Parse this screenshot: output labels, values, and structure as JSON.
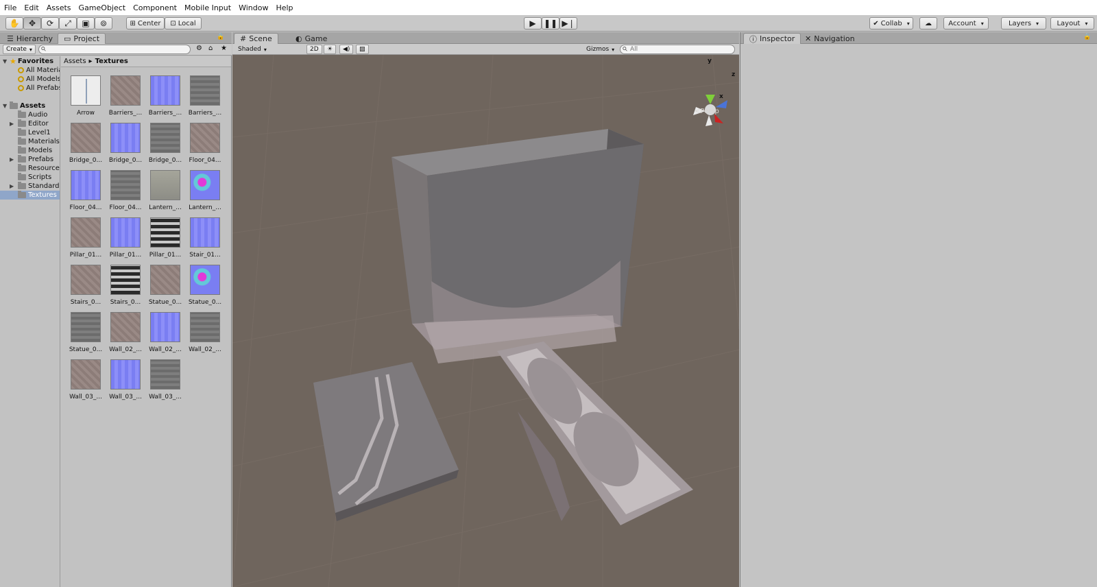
{
  "menu": [
    "File",
    "Edit",
    "Assets",
    "GameObject",
    "Component",
    "Mobile Input",
    "Window",
    "Help"
  ],
  "toolbar": {
    "tools": [
      "hand-icon",
      "move-icon",
      "rotate-icon",
      "scale-icon",
      "rect-icon",
      "transform-icon"
    ],
    "pivot": "Center",
    "space": "Local",
    "collab": "Collab",
    "account": "Account",
    "layers": "Layers",
    "layout": "Layout"
  },
  "left_tabs": {
    "hierarchy": "Hierarchy",
    "project": "Project"
  },
  "project_bar": {
    "create": "Create"
  },
  "tree": {
    "favorites": "Favorites",
    "fav_items": [
      "All Materials",
      "All Models",
      "All Prefabs"
    ],
    "assets": "Assets",
    "folders": [
      "Audio",
      "Editor",
      "Level1",
      "Materials",
      "Models",
      "Prefabs",
      "Resources",
      "Scripts",
      "Standard Assets",
      "Textures"
    ]
  },
  "breadcrumb": {
    "root": "Assets",
    "current": "Textures"
  },
  "textures": [
    {
      "name": "Arrow",
      "kind": "arrow"
    },
    {
      "name": "Barriers_...",
      "kind": "diff"
    },
    {
      "name": "Barriers_...",
      "kind": "norm"
    },
    {
      "name": "Barriers_...",
      "kind": "gray"
    },
    {
      "name": "Bridge_0...",
      "kind": "diff"
    },
    {
      "name": "Bridge_0...",
      "kind": "norm"
    },
    {
      "name": "Bridge_0...",
      "kind": "gray"
    },
    {
      "name": "Floor_04...",
      "kind": "diff"
    },
    {
      "name": "Floor_04...",
      "kind": "norm"
    },
    {
      "name": "Floor_04...",
      "kind": "gray"
    },
    {
      "name": "Lantern_...",
      "kind": "lant"
    },
    {
      "name": "Lantern_...",
      "kind": "lantn"
    },
    {
      "name": "Pillar_01...",
      "kind": "diff"
    },
    {
      "name": "Pillar_01...",
      "kind": "norm"
    },
    {
      "name": "Pillar_01...",
      "kind": "dark"
    },
    {
      "name": "Stair_01...",
      "kind": "norm"
    },
    {
      "name": "Stairs_0...",
      "kind": "diff"
    },
    {
      "name": "Stairs_0...",
      "kind": "dark"
    },
    {
      "name": "Statue_0...",
      "kind": "diff"
    },
    {
      "name": "Statue_0...",
      "kind": "lantn"
    },
    {
      "name": "Statue_0...",
      "kind": "gray"
    },
    {
      "name": "Wall_02_...",
      "kind": "diff"
    },
    {
      "name": "Wall_02_...",
      "kind": "norm"
    },
    {
      "name": "Wall_02_...",
      "kind": "gray"
    },
    {
      "name": "Wall_03_...",
      "kind": "diff"
    },
    {
      "name": "Wall_03_...",
      "kind": "norm"
    },
    {
      "name": "Wall_03_...",
      "kind": "gray"
    }
  ],
  "scene_tabs": {
    "scene": "Scene",
    "game": "Game"
  },
  "scene_bar": {
    "shading": "Shaded",
    "mode2d": "2D",
    "gizmos": "Gizmos",
    "search_placeholder": "All"
  },
  "gizmo": {
    "y": "y",
    "z": "z",
    "x": "x",
    "projection": "Persp"
  },
  "right_tabs": {
    "inspector": "Inspector",
    "navigation": "Navigation"
  },
  "colors": {
    "viewport": "#6f655d",
    "selection": "#8fa6c9",
    "normal_map": "#7a7ef2"
  }
}
